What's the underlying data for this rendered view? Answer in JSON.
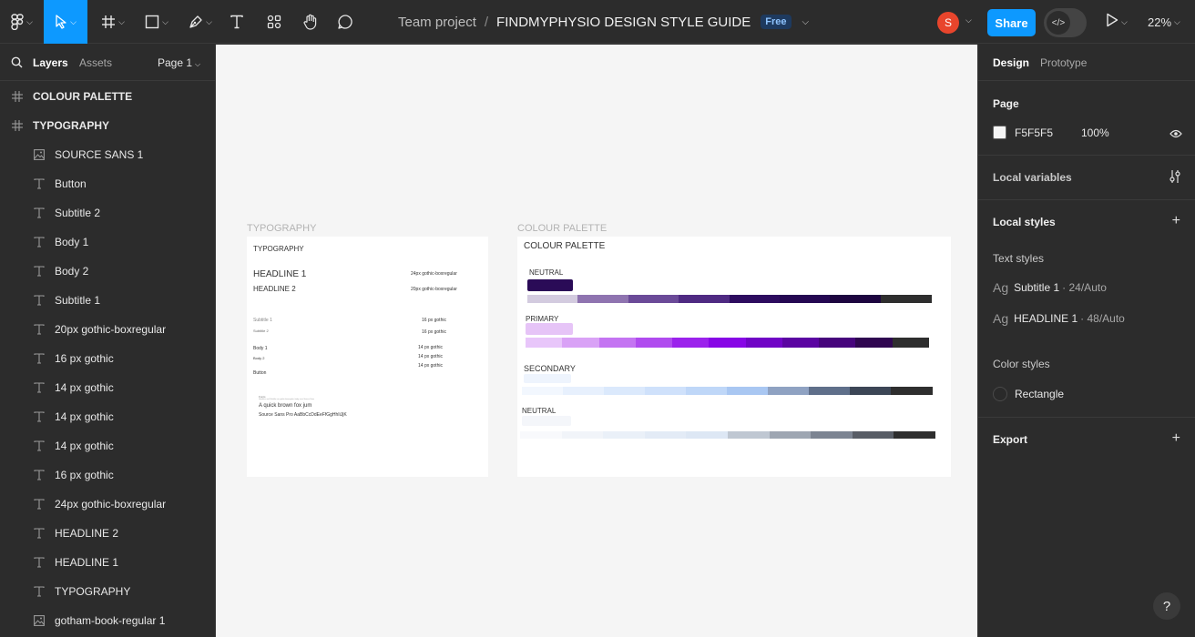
{
  "toolbar": {
    "project": "Team project",
    "separator": "/",
    "file_name": "FINDMYPHYSIO DESIGN STYLE GUIDE",
    "plan_badge": "Free",
    "avatar_initial": "S",
    "share_label": "Share",
    "zoom": "22%",
    "tools": [
      "figma-menu-icon",
      "move-tool-icon",
      "frame-tool-icon",
      "shape-tool-icon",
      "pen-tool-icon",
      "text-tool-icon",
      "resources-icon",
      "hand-tool-icon",
      "comment-icon"
    ]
  },
  "left_panel": {
    "tab_layers": "Layers",
    "tab_assets": "Assets",
    "page": "Page 1",
    "layers": [
      {
        "name": "COLOUR PALETTE",
        "type": "frame"
      },
      {
        "name": "TYPOGRAPHY",
        "type": "frame"
      },
      {
        "name": "SOURCE SANS 1",
        "type": "image"
      },
      {
        "name": "Button",
        "type": "text"
      },
      {
        "name": "Subtitle 2",
        "type": "text"
      },
      {
        "name": "Body 1",
        "type": "text"
      },
      {
        "name": "Body 2",
        "type": "text"
      },
      {
        "name": "Subtitle 1",
        "type": "text"
      },
      {
        "name": "20px gothic-boxregular",
        "type": "text"
      },
      {
        "name": "16 px gothic",
        "type": "text"
      },
      {
        "name": "14 px gothic",
        "type": "text"
      },
      {
        "name": "14 px gothic",
        "type": "text"
      },
      {
        "name": "14 px gothic",
        "type": "text"
      },
      {
        "name": "16 px gothic",
        "type": "text"
      },
      {
        "name": "24px gothic-boxregular",
        "type": "text"
      },
      {
        "name": "HEADLINE 2",
        "type": "text"
      },
      {
        "name": "HEADLINE 1",
        "type": "text"
      },
      {
        "name": "TYPOGRAPHY",
        "type": "text"
      },
      {
        "name": "gotham-book-regular 1",
        "type": "image"
      }
    ]
  },
  "canvas": {
    "typography_frame": {
      "label": "TYPOGRAPHY",
      "title": "TYPOGRAPHY",
      "headline1": "HEADLINE 1",
      "headline1_spec": "24px gothic-boxregular",
      "headline2": "HEADLINE 2",
      "headline2_spec": "20px gothic-boxregular",
      "subtitle1": "Subtitle 1",
      "subtitle1_spec": "16 px gothic",
      "subtitle2": "Subtitle 2",
      "subtitle2_spec": "16 px gothic",
      "body1": "Body 1",
      "body1_spec": "14 px gothic",
      "body2": "Body 2",
      "body2_spec": "14 px gothic",
      "button": "Button",
      "button_spec": "14 px gothic",
      "sample_heading": "Fonts",
      "sample_sub": "Headline and Subtitle use gothic-boxregular, body uses Source Sans",
      "sample_line": "A quick brown fox jum",
      "sample_font": "Source Sans Pro AaBbCcDdEeFfGgHhIiJjK"
    },
    "palette_frame": {
      "label": "COLOUR PALETTE",
      "title": "COLOUR PALETTE",
      "groups": [
        {
          "name": "NEUTRAL",
          "swatch": "#2a0b57",
          "ramp": [
            "#d3cbdf",
            "#8f74b0",
            "#6b4a98",
            "#4f2a82",
            "#2d0c5f",
            "#250852",
            "#1d0640",
            "#2e2e2e"
          ]
        },
        {
          "name": "PRIMARY",
          "swatch": "#e6c4f7",
          "ramp": [
            "#e8c6fa",
            "#d9a2f6",
            "#c474f2",
            "#b04bef",
            "#9b22ec",
            "#8706e6",
            "#7004c6",
            "#5b04a2",
            "#46047c",
            "#2f0650",
            "#2e2e2e"
          ]
        },
        {
          "name": "SECONDARY",
          "swatch": "#eef4fd",
          "ramp": [
            "#f2f7fe",
            "#e7f0fd",
            "#dbe9fc",
            "#cfe1fb",
            "#bfd7f8",
            "#a9c7f2",
            "#8fa2c2",
            "#5f6f8a",
            "#3c4656",
            "#2e2e2e"
          ]
        },
        {
          "name": "NEUTRAL",
          "swatch": "#f4f6fa",
          "ramp": [
            "#f8f9fc",
            "#f1f4f9",
            "#eaf0f8",
            "#e3ebf6",
            "#dde7f4",
            "#bfc7d2",
            "#9ea6b2",
            "#7c8492",
            "#585d66",
            "#2e2e2e"
          ]
        }
      ]
    }
  },
  "right_panel": {
    "tab_design": "Design",
    "tab_prototype": "Prototype",
    "page_heading": "Page",
    "page_color": "F5F5F5",
    "page_opacity": "100%",
    "local_variables": "Local variables",
    "local_styles": "Local styles",
    "text_styles_heading": "Text styles",
    "text_styles": [
      {
        "ag": "Ag",
        "name": "Subtitle 1",
        "meta": "· 24/Auto"
      },
      {
        "ag": "Ag",
        "name": "HEADLINE 1",
        "meta": "· 48/Auto"
      }
    ],
    "color_styles_heading": "Color styles",
    "color_style_name": "Rectangle",
    "export": "Export",
    "help": "?"
  },
  "colors": {
    "accent": "#0d99ff",
    "panel_bg": "#2c2c2c",
    "canvas_bg": "#f5f5f5"
  }
}
